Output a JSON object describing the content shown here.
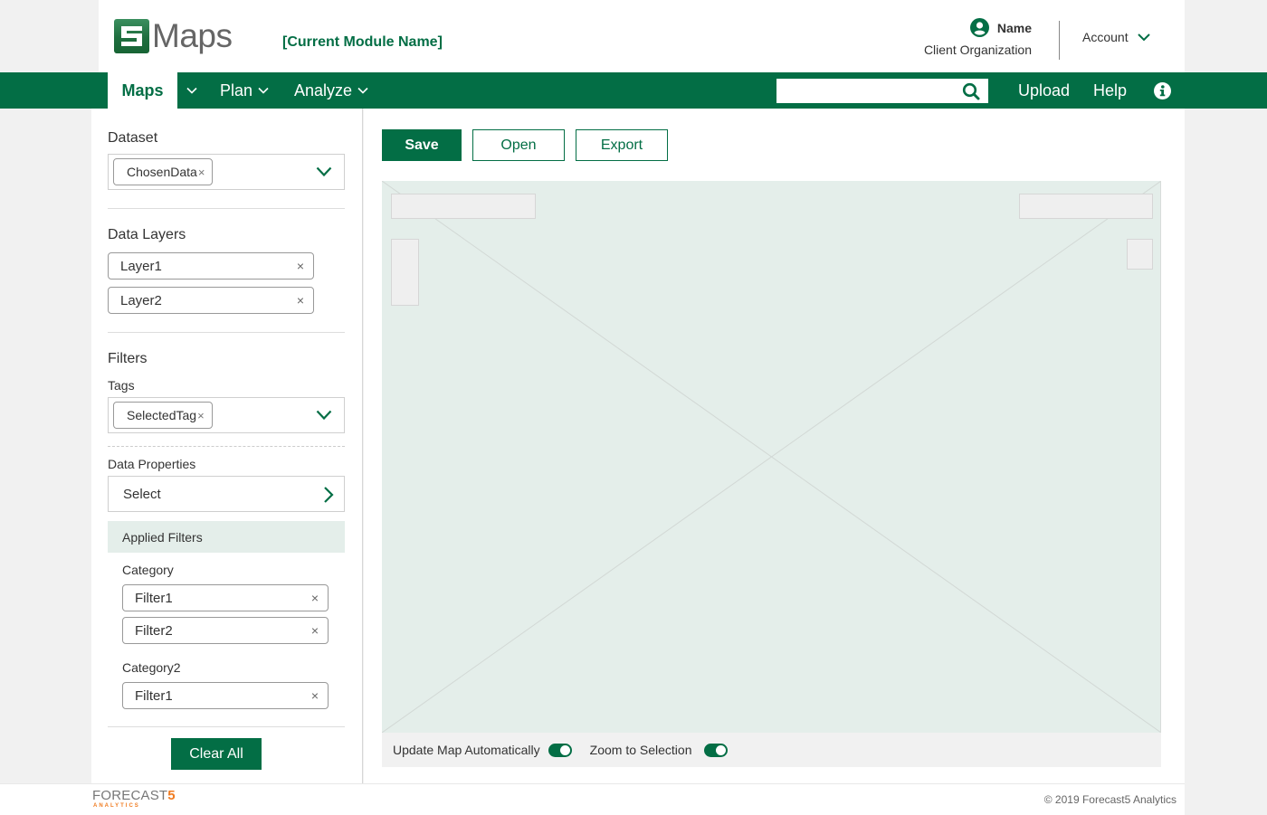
{
  "app": {
    "logo_text": "Maps",
    "logo_digit": "5",
    "module_name": "[Current Module Name]"
  },
  "user": {
    "name": "Name",
    "organization": "Client Organization",
    "account_label": "Account"
  },
  "nav": {
    "items": [
      {
        "label": "Maps",
        "active": true
      },
      {
        "label": "Plan"
      },
      {
        "label": "Analyze"
      }
    ],
    "search_placeholder": "",
    "search_value": "",
    "upload_label": "Upload",
    "help_label": "Help"
  },
  "sidebar": {
    "dataset": {
      "label": "Dataset",
      "selected": "ChosenData"
    },
    "data_layers": {
      "label": "Data Layers",
      "items": [
        "Layer1",
        "Layer2"
      ]
    },
    "filters": {
      "label": "Filters",
      "tags_label": "Tags",
      "tags_selected": "SelectedTag",
      "data_properties_label": "Data Properties",
      "data_properties_value": "Select",
      "applied_filters_label": "Applied Filters",
      "categories": [
        {
          "name": "Category",
          "filters": [
            "Filter1",
            "Filter2"
          ]
        },
        {
          "name": "Category2",
          "filters": [
            "Filter1"
          ]
        }
      ],
      "clear_all_label": "Clear All"
    }
  },
  "toolbar": {
    "save_label": "Save",
    "open_label": "Open",
    "export_label": "Export"
  },
  "map_options": {
    "update_automatically_label": "Update Map Automatically",
    "update_automatically_on": true,
    "zoom_to_selection_label": "Zoom to Selection",
    "zoom_to_selection_on": true
  },
  "footer": {
    "brand_main": "FORECAST",
    "brand_digit": "5",
    "brand_sub": "ANALYTICS",
    "copyright": "© 2019 Forecast5 Analytics"
  },
  "colors": {
    "brand_green": "#036e45",
    "map_background": "#e4eeea",
    "forecast_orange": "#f07c22"
  }
}
